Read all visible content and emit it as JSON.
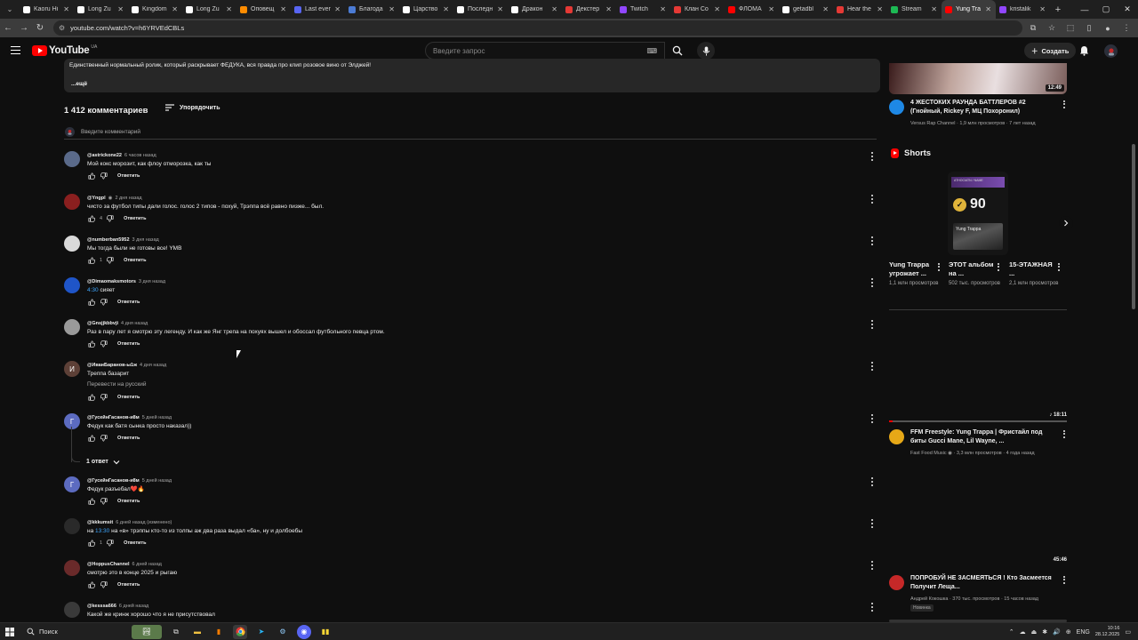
{
  "browser": {
    "tabs": [
      {
        "label": "Kaoru Hi",
        "color": "#ffffff"
      },
      {
        "label": "Long Zu",
        "color": "#ffffff"
      },
      {
        "label": "Kingdom",
        "color": "#ffffff"
      },
      {
        "label": "Long Zu",
        "color": "#ffffff"
      },
      {
        "label": "Оповещ",
        "color": "#ff8c00"
      },
      {
        "label": "Last ever",
        "color": "#5865f2"
      },
      {
        "label": "Благода",
        "color": "#4b7bd4"
      },
      {
        "label": "Царство",
        "color": "#ffffff"
      },
      {
        "label": "Последн",
        "color": "#ffffff"
      },
      {
        "label": "Дракон",
        "color": "#ffffff"
      },
      {
        "label": "Декстер",
        "color": "#e53935"
      },
      {
        "label": "Twitch",
        "color": "#9146ff"
      },
      {
        "label": "Клан Со",
        "color": "#e53935"
      },
      {
        "label": "ФЛОМА",
        "color": "#ff0000"
      },
      {
        "label": "getadbl",
        "color": "#ffffff"
      },
      {
        "label": "Hear the",
        "color": "#e53935"
      },
      {
        "label": "Stream",
        "color": "#1db954"
      },
      {
        "label": "Yung Tra",
        "color": "#ff0000",
        "active": true
      },
      {
        "label": "kristalik",
        "color": "#9146ff"
      }
    ],
    "url": "youtube.com/watch?v=h6YRVEdCBLs"
  },
  "youtube": {
    "logo_text": "YouTube",
    "region": "UA",
    "search_placeholder": "Введите запрос",
    "create_label": "Создать"
  },
  "description": {
    "text": "Единственный нормальный ролик, который раскрывает ФЕДУКА, вся правда про клип розовое вино от Элджей!",
    "more": "...ещё"
  },
  "comments_header": {
    "count": "1 412 комментариев",
    "sort_label": "Упорядочить",
    "add_placeholder": "Введите комментарий"
  },
  "comments": [
    {
      "user": "@astrickone22",
      "time": "6 часов назад",
      "text": "Мой кокс морозит, как флоу отморозка, как ты",
      "likes": "",
      "avatar_color": "#5a6a8a",
      "avatar_letter": ""
    },
    {
      "user": "@Yngpl",
      "verified": "◉",
      "time": "2 дня назад",
      "text": "чисто за футбол типы дали голос. голос 2 типов - похуй, Трэппа всё равно пизже... был.",
      "likes": "4",
      "avatar_color": "#8a1f1f",
      "avatar_letter": ""
    },
    {
      "user": "@numberban5952",
      "time": "3 дня назад",
      "text": "Мы тогда были не готовы все! YMB",
      "likes": "1",
      "avatar_color": "#d9d9d9",
      "avatar_letter": ""
    },
    {
      "user": "@Dimaomaksmotors",
      "time": "3 дня назад",
      "ts": "4:30",
      "text": " сияет",
      "likes": "",
      "avatar_color": "#1f55c8",
      "avatar_letter": ""
    },
    {
      "user": "@Gnsjjkbbvji",
      "time": "4 дня назад",
      "text": "Раз в пару лет я смотрю эту легенду. И как же Янг трепа на похуях вышел и обоссал футбольного певца ртом.",
      "likes": "",
      "avatar_color": "#9a9a9a",
      "avatar_letter": ""
    },
    {
      "user": "@ИванБаранов-ы1ж",
      "time": "4 дня назад",
      "text": "Треппа базарит",
      "translate": "Перевести на русский",
      "likes": "",
      "avatar_color": "#5d4037",
      "avatar_letter": "И"
    },
    {
      "user": "@ГусейнГасанов-и8м",
      "time": "5 дней назад",
      "text": "Федук как батя сынка просто наказал))",
      "likes": "",
      "avatar_color": "#5c6bc0",
      "avatar_letter": "Г"
    },
    {
      "user": "@ГусейнГасанов-и8м",
      "time": "5 дней назад",
      "text": "Федук разъебал❤️🔥",
      "likes": "",
      "avatar_color": "#5c6bc0",
      "avatar_letter": "Г"
    },
    {
      "user": "@kkkumsit",
      "time": "6 дней назад (изменено)",
      "ts": "13:30",
      "pre": "на ",
      "text": " на «в» трэппы кто-то из толпы аж два раза выдал «ба», ну и долбоебы",
      "likes": "1",
      "avatar_color": "#2a2a2a",
      "avatar_letter": ""
    },
    {
      "user": "@HoppusChannel",
      "time": "6 дней назад",
      "text": "смотрю это в конце 2025 и рыгаю",
      "likes": "",
      "avatar_color": "#6a2a2a",
      "avatar_letter": ""
    },
    {
      "user": "@kesssa666",
      "time": "6 дней назад",
      "text": "Какой же кринж хорошо что я не присутствовал",
      "likes": "",
      "avatar_color": "#3a3a3a",
      "avatar_letter": ""
    }
  ],
  "actions": {
    "reply": "Ответить",
    "replies_toggle": "1 ответ"
  },
  "sidebar": {
    "video1": {
      "duration": "12:49",
      "title": "4 ЖЕСТОКИХ РАУНДА БАТТЛЕРОВ #2 (Гнойный, Rickey F, МЦ Похоронил)",
      "meta": "Versus Rap Channel · 1,9 млн просмотров · 7 лет назад",
      "avatar_color": "#1e88e5"
    },
    "shorts_title": "Shorts",
    "short_thumb": {
      "header": "ATHOCIATN / NAME",
      "score": "90",
      "check": "✓",
      "art_text": "Yung Trappa"
    },
    "shorts": [
      {
        "title": "Yung Trappa угрожает ...",
        "views": "1,1 млн просмотров"
      },
      {
        "title": "ЭТОТ альбом на ...",
        "views": "502 тыс. просмотров"
      },
      {
        "title": "15-ЭТАЖНАЯ ...",
        "views": "2,1 млн просмотров"
      }
    ],
    "video2": {
      "duration": "18:11",
      "progress": 0.02,
      "title": "FFM Freestyle: Yung Trappa | Фристайл под биты Gucci Mane, Lil Wayne, ...",
      "meta": "Fast Food Music ◉ · 3,3 млн просмотров · 4 года назад",
      "avatar_color": "#e6a817"
    },
    "video3": {
      "duration": "45:46",
      "title": "ПОПРОБУЙ НЕ ЗАСМЕЯТЬСЯ ! Кто Засмеется Получит Леща...",
      "meta": "Андрей Кокошка · 370 тыс. просмотров · 15 часов назад",
      "badge": "Новинка",
      "avatar_color": "#c62828"
    }
  },
  "taskbar": {
    "search_label": "Поиск",
    "lang": "ENG",
    "time": "10:16",
    "date": "28.12.2025"
  }
}
